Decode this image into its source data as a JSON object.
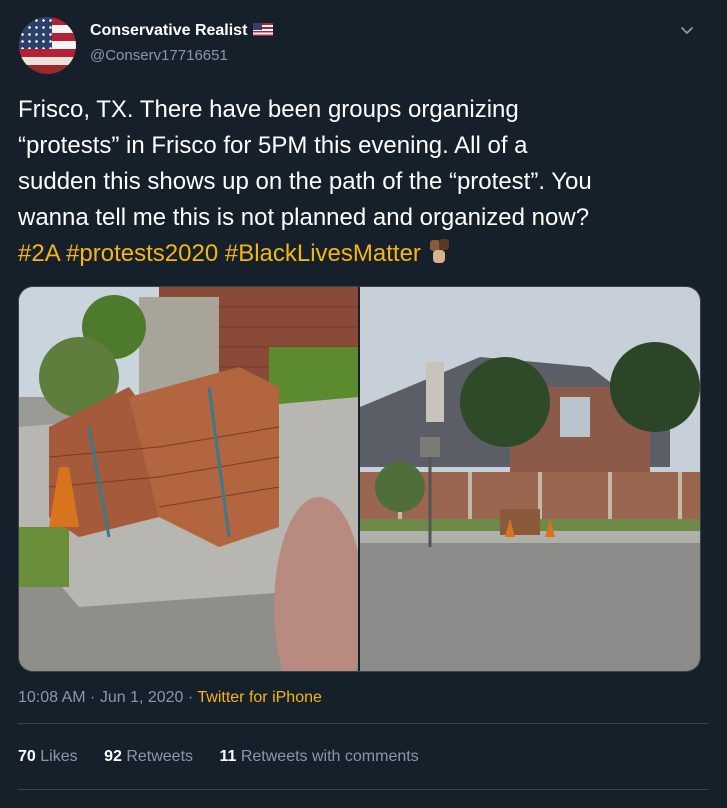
{
  "author": {
    "name": "Conservative Realist",
    "handle": "@Conserv17716651"
  },
  "tweet": {
    "lines": [
      "Frisco, TX.  There have been groups organizing",
      "“protests” in Frisco for 5PM this evening.  All of a",
      "sudden this shows up on the path of the “protest”.  You",
      "wanna tell me this is not planned and organized now?"
    ],
    "hashtags": [
      "#2A",
      "#protests2020",
      "#BlackLivesMatter"
    ]
  },
  "meta": {
    "time": "10:08 AM",
    "date": "Jun 1, 2020",
    "source": "Twitter for iPhone"
  },
  "stats": {
    "likes_count": "70",
    "likes_label": "Likes",
    "retweets_count": "92",
    "retweets_label": "Retweets",
    "comments_count": "11",
    "comments_label": "Retweets with comments"
  },
  "icons": [
    "us-flag-icon",
    "chevron-down-icon",
    "raised-fists-icon"
  ],
  "colors": {
    "background": "#15202b",
    "hashtag": "#f5b60f",
    "muted": "#8899a6"
  }
}
